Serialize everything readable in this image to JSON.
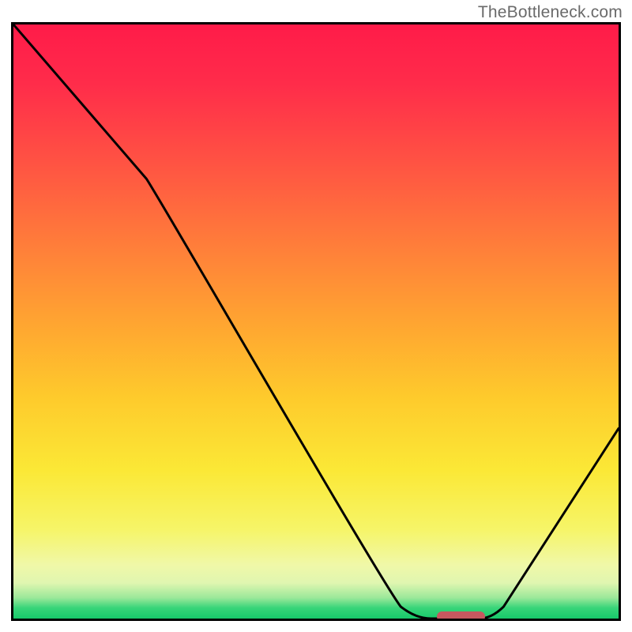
{
  "watermark": "TheBottleneck.com",
  "chart_data": {
    "type": "line",
    "title": "",
    "xlabel": "",
    "ylabel": "",
    "x_range": [
      0,
      100
    ],
    "y_range": [
      0,
      100
    ],
    "curve_points": [
      {
        "x": 0,
        "y": 100
      },
      {
        "x": 22,
        "y": 74
      },
      {
        "x": 64,
        "y": 2
      },
      {
        "x": 69,
        "y": 0
      },
      {
        "x": 77,
        "y": 0
      },
      {
        "x": 81,
        "y": 2
      },
      {
        "x": 100,
        "y": 32
      }
    ],
    "optimum_marker": {
      "x_start": 70,
      "x_end": 78,
      "y": 0
    },
    "gradient_scale": [
      "#ff1b49",
      "#ff8638",
      "#fecb2c",
      "#f6f568",
      "#38d579"
    ]
  }
}
